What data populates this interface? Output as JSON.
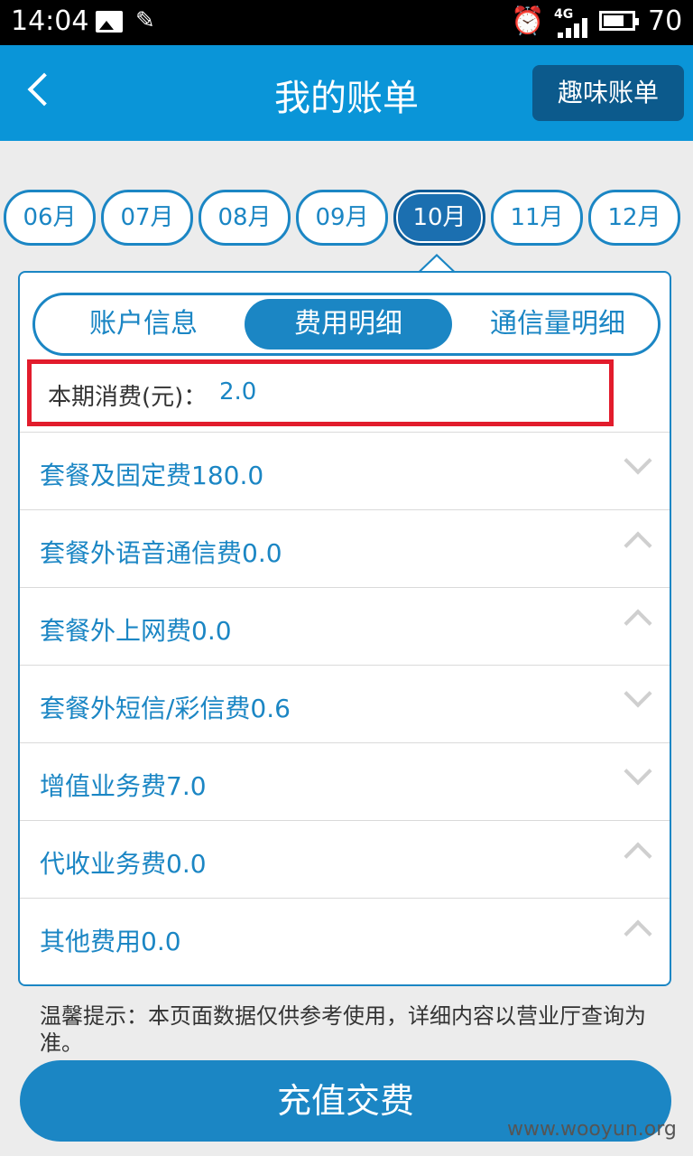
{
  "status_bar": {
    "time": "14:04",
    "network": "4G",
    "battery": "70"
  },
  "header": {
    "title": "我的账单",
    "fun_bill_button": "趣味账单"
  },
  "months": [
    {
      "label": "06月",
      "active": false
    },
    {
      "label": "07月",
      "active": false
    },
    {
      "label": "08月",
      "active": false
    },
    {
      "label": "09月",
      "active": false
    },
    {
      "label": "10月",
      "active": true
    },
    {
      "label": "11月",
      "active": false
    },
    {
      "label": "12月",
      "active": false
    }
  ],
  "tabs": [
    {
      "label": "账户信息",
      "active": false
    },
    {
      "label": "费用明细",
      "active": true
    },
    {
      "label": "通信量明细",
      "active": false
    }
  ],
  "summary": {
    "label": "本期消费(元)：",
    "value": "2.0"
  },
  "items": [
    {
      "label": "套餐及固定费180.0",
      "chevron": "down"
    },
    {
      "label": "套餐外语音通信费0.0",
      "chevron": "up"
    },
    {
      "label": "套餐外上网费0.0",
      "chevron": "up"
    },
    {
      "label": "套餐外短信/彩信费0.6",
      "chevron": "down"
    },
    {
      "label": "增值业务费7.0",
      "chevron": "down"
    },
    {
      "label": "代收业务费0.0",
      "chevron": "up"
    },
    {
      "label": "其他费用0.0",
      "chevron": "up"
    }
  ],
  "tip": "温馨提示：本页面数据仅供参考使用，详细内容以营业厅查询为准。",
  "recharge_button": "充值交费",
  "watermark": "www.wooyun.org",
  "colors": {
    "accent": "#1b86c4",
    "header": "#0a95d8",
    "highlight": "#e21c2c"
  }
}
